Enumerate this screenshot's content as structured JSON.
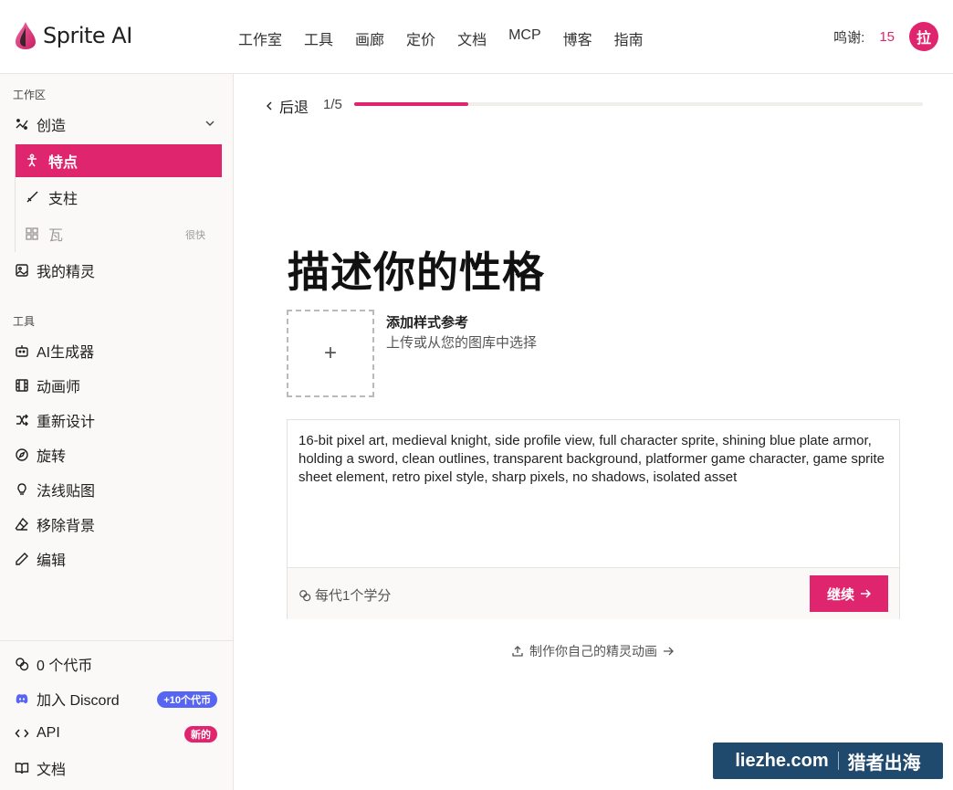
{
  "brand": {
    "name": "Sprite AI"
  },
  "nav": [
    "工作室",
    "工具",
    "画廊",
    "定价",
    "文档",
    "MCP",
    "博客",
    "指南"
  ],
  "header": {
    "credits_label": "鸣谢:",
    "credits_value": "15",
    "avatar_initial": "拉"
  },
  "sidebar": {
    "workspace_label": "工作区",
    "create": {
      "label": "创造",
      "icon": "sparkles-icon"
    },
    "sub_items": [
      {
        "label": "特点",
        "icon": "person-icon",
        "active": true
      },
      {
        "label": "支柱",
        "icon": "sword-icon"
      },
      {
        "label": "瓦",
        "icon": "grid-icon",
        "tag": "很快"
      }
    ],
    "my_sprites": {
      "label": "我的精灵",
      "icon": "image-icon"
    },
    "tools_label": "工具",
    "tools": [
      {
        "label": "AI生成器",
        "icon": "bot-icon"
      },
      {
        "label": "动画师",
        "icon": "film-icon"
      },
      {
        "label": "重新设计",
        "icon": "shuffle-icon"
      },
      {
        "label": "旋转",
        "icon": "compass-icon"
      },
      {
        "label": "法线贴图",
        "icon": "bulb-icon"
      },
      {
        "label": "移除背景",
        "icon": "eraser-icon"
      },
      {
        "label": "编辑",
        "icon": "pencil-icon"
      }
    ],
    "bottom": {
      "coins": {
        "label": "0 个代币",
        "icon": "coins-icon"
      },
      "discord": {
        "label": "加入 Discord",
        "badge": "+10个代币",
        "icon": "discord-icon"
      },
      "api": {
        "label": "API",
        "badge": "新的",
        "icon": "code-icon"
      },
      "docs": {
        "label": "文档",
        "icon": "book-icon"
      }
    }
  },
  "main": {
    "back_label": "后退",
    "step": "1/5",
    "progress": 0.2,
    "title": "描述你的性格",
    "style_ref": {
      "title": "添加样式参考",
      "subtitle": "上传或从您的图库中选择",
      "plus": "+"
    },
    "prompt": "16-bit pixel art, medieval knight, side profile view, full character sprite, shining blue plate armor, holding a sword, clean outlines, transparent background, platformer game character, game sprite sheet element, retro pixel style, sharp pixels, no shadows, isolated asset",
    "cost": "每代1个学分",
    "continue_label": "继续",
    "animation_link": "制作你自己的精灵动画"
  },
  "watermark": {
    "left": "liezhe.com",
    "right": "猎者出海"
  },
  "colors": {
    "accent": "#e0256f",
    "discord": "#5865f2",
    "watermark_bg": "#1f4a6e"
  }
}
